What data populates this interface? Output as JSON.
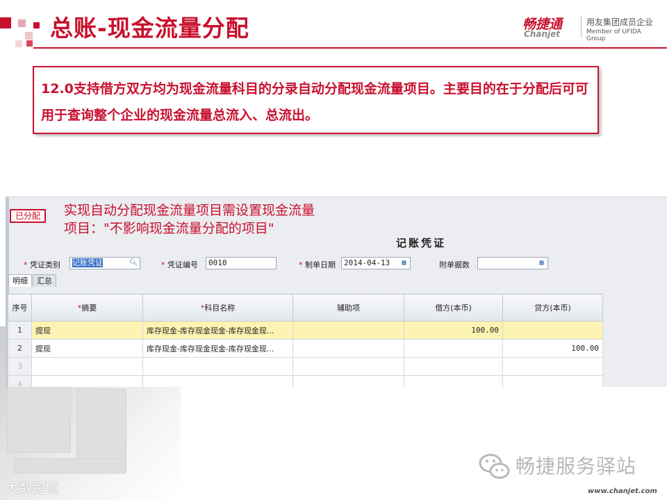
{
  "slide": {
    "title": "总账-现金流量分配",
    "callout_text": "12.0支持借方双方均为现金流量科目的分录自动分配现金流量项目。主要目的在于分配后可可用于查询整个企业的现金流量总流入、总流出。",
    "watermark_left": "大数跨境",
    "wechat_account": "畅捷服务驿站",
    "website": "www.chanjet.com"
  },
  "logo": {
    "brand_cn": "畅捷通",
    "brand_en": "Chanjet",
    "member_cn": "用友集团成员企业",
    "member_en": "Member of UFIDA Group"
  },
  "colors": {
    "brand_red": "#c8102e",
    "row_highlight": "#fdf3b3",
    "header_bg": "#e3e7ed"
  },
  "screenshot": {
    "status_stamp": "已分配",
    "annotation_line1": "实现自动分配现金流量项目需设置现金流量",
    "annotation_line2": "项目：\"不影响现金流量分配的项目\"",
    "voucher_title": "记账凭证",
    "form": {
      "voucher_type_label": "凭证类别",
      "voucher_type_value": "记账凭证",
      "voucher_no_label": "凭证编号",
      "voucher_no_value": "0010",
      "date_label": "制单日期",
      "date_value": "2014-04-13",
      "attachments_label": "附单据数",
      "attachments_value": ""
    },
    "tabs": [
      "明细",
      "汇总"
    ],
    "columns": [
      "序号",
      "摘要",
      "科目名称",
      "辅助项",
      "借方(本币)",
      "贷方(本币)"
    ],
    "rows": [
      {
        "no": "1",
        "summary": "提现",
        "account": "库存现金-库存现金现金-库存现金现...",
        "aux": "",
        "debit": "100.00",
        "credit": ""
      },
      {
        "no": "2",
        "summary": "提现",
        "account": "库存现金-库存现金现金-库存现金现...",
        "aux": "",
        "debit": "",
        "credit": "100.00"
      },
      {
        "no": "3",
        "summary": "",
        "account": "",
        "aux": "",
        "debit": "",
        "credit": ""
      },
      {
        "no": "4",
        "summary": "",
        "account": "",
        "aux": "",
        "debit": "",
        "credit": ""
      }
    ]
  }
}
